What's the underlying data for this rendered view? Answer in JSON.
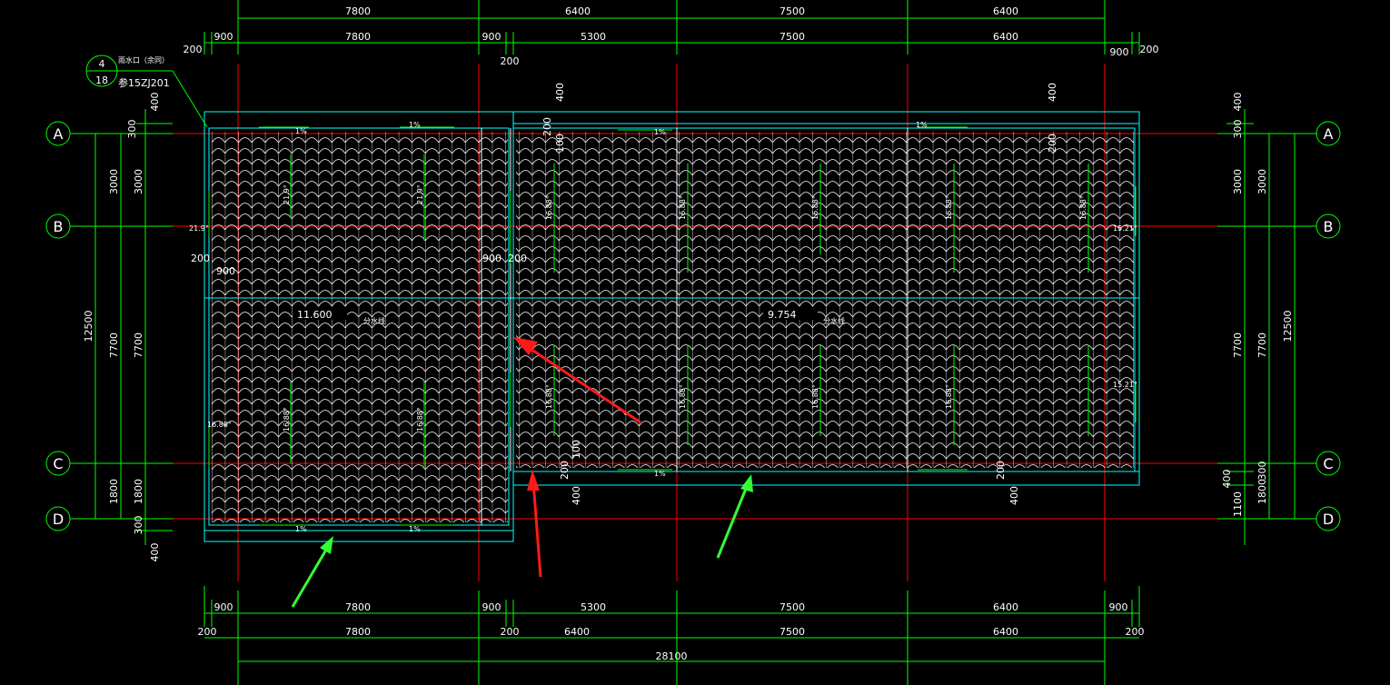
{
  "drawing": {
    "top_dims_row1": [
      "7800",
      "6400",
      "7500",
      "6400"
    ],
    "top_dims_row2": [
      "900",
      "7800",
      "900",
      "5300",
      "7500",
      "6400",
      "900"
    ],
    "top_dims_small": [
      "200",
      "200",
      "200"
    ],
    "bottom_dims_row1": [
      "900",
      "7800",
      "900",
      "5300",
      "7500",
      "6400",
      "900"
    ],
    "bottom_dims_row2": [
      "200",
      "7800",
      "200",
      "6400",
      "7500",
      "6400",
      "200"
    ],
    "bottom_total": "28100",
    "axes": [
      "A",
      "B",
      "C",
      "D"
    ],
    "left_dims_outer": [
      "12500"
    ],
    "left_dims_mid": [
      "3000",
      "7700",
      "1800"
    ],
    "left_dims_inner": [
      "300",
      "3000",
      "7700",
      "1800",
      "300"
    ],
    "left_dims_misc": [
      "400",
      "400"
    ],
    "right_dims_outer": [
      "12500"
    ],
    "right_dims_mid": [
      "3000",
      "7700",
      "1800"
    ],
    "right_dims_inner": [
      "300",
      "3000",
      "7700",
      "300",
      "400",
      "1100",
      "1100"
    ],
    "right_dims_misc": [
      "400"
    ],
    "callout": {
      "top": "4",
      "bottom": "18",
      "text1": "雨水口（余同）",
      "text2": "参15ZJ201"
    },
    "elevations": [
      "11.600",
      "9.754"
    ],
    "ridge_label": "分水线",
    "slopes": [
      "1%",
      "1%",
      "1%",
      "1%",
      "1%",
      "1%",
      "1%"
    ],
    "angles": [
      "21.9°",
      "21.9°",
      "21.9°",
      "16.88°",
      "16.88°",
      "16.88°",
      "16.88°",
      "16.88°",
      "16.88°",
      "16.88°",
      "16.88°",
      "16.88°",
      "16.88°",
      "16.88°",
      "16.88°",
      "15.21°",
      "15.21°"
    ],
    "internal_dims": [
      "200",
      "900",
      "900",
      "200",
      "400",
      "200",
      "100",
      "200",
      "400",
      "100",
      "200",
      "400",
      "200",
      "400"
    ],
    "colors": {
      "grid": "#ff0000",
      "dim": "#00ff00",
      "outline": "#00ffff",
      "text": "#ffffff",
      "arrow_red": "#ff1a1a",
      "arrow_green": "#33ff33"
    }
  }
}
